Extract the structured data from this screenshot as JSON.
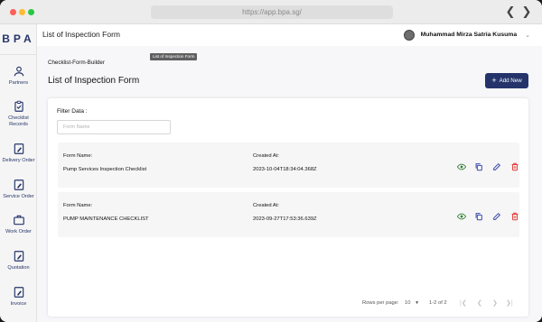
{
  "browser": {
    "url": "https://app.bpa.sg/"
  },
  "sidebar": {
    "logo": "BPA",
    "items": [
      {
        "label": "Partners",
        "icon": "person-icon"
      },
      {
        "label": "Checklist Records",
        "icon": "clipboard-check-icon"
      },
      {
        "label": "Delivery Order",
        "icon": "edit-document-icon"
      },
      {
        "label": "Service Order",
        "icon": "edit-document-icon"
      },
      {
        "label": "Work Order",
        "icon": "briefcase-icon"
      },
      {
        "label": "Quotation",
        "icon": "edit-document-icon"
      },
      {
        "label": "Invoice",
        "icon": "edit-document-icon"
      }
    ]
  },
  "header": {
    "title": "List of Inspection Form",
    "user_name": "Muhammad Mirza Satria Kusuma",
    "tooltip": "List of Inspection Form"
  },
  "main": {
    "breadcrumb": "Checklist-Form-Builder",
    "title": "List of Inspection Form",
    "add_button": "Add New",
    "filter_label": "Filter Data :",
    "filter_placeholder": "Form Name",
    "form_name_label": "Form Name:",
    "created_at_label": "Created At:",
    "rows": [
      {
        "form_name": "Pump Services Inspection Checklist",
        "created_at": "2023-10-04T18:34:04.368Z"
      },
      {
        "form_name": "PUMP MAINTENANCE CHECKLIST",
        "created_at": "2023-09-27T17:53:36.639Z"
      }
    ],
    "pagination": {
      "rows_per_page_label": "Rows per page:",
      "rows_per_page_value": "10",
      "range": "1-2 of 2"
    }
  },
  "colors": {
    "brand": "#24346b",
    "view": "#2e7d32",
    "copy": "#3949ab",
    "edit": "#3949ab",
    "delete": "#e53935"
  }
}
